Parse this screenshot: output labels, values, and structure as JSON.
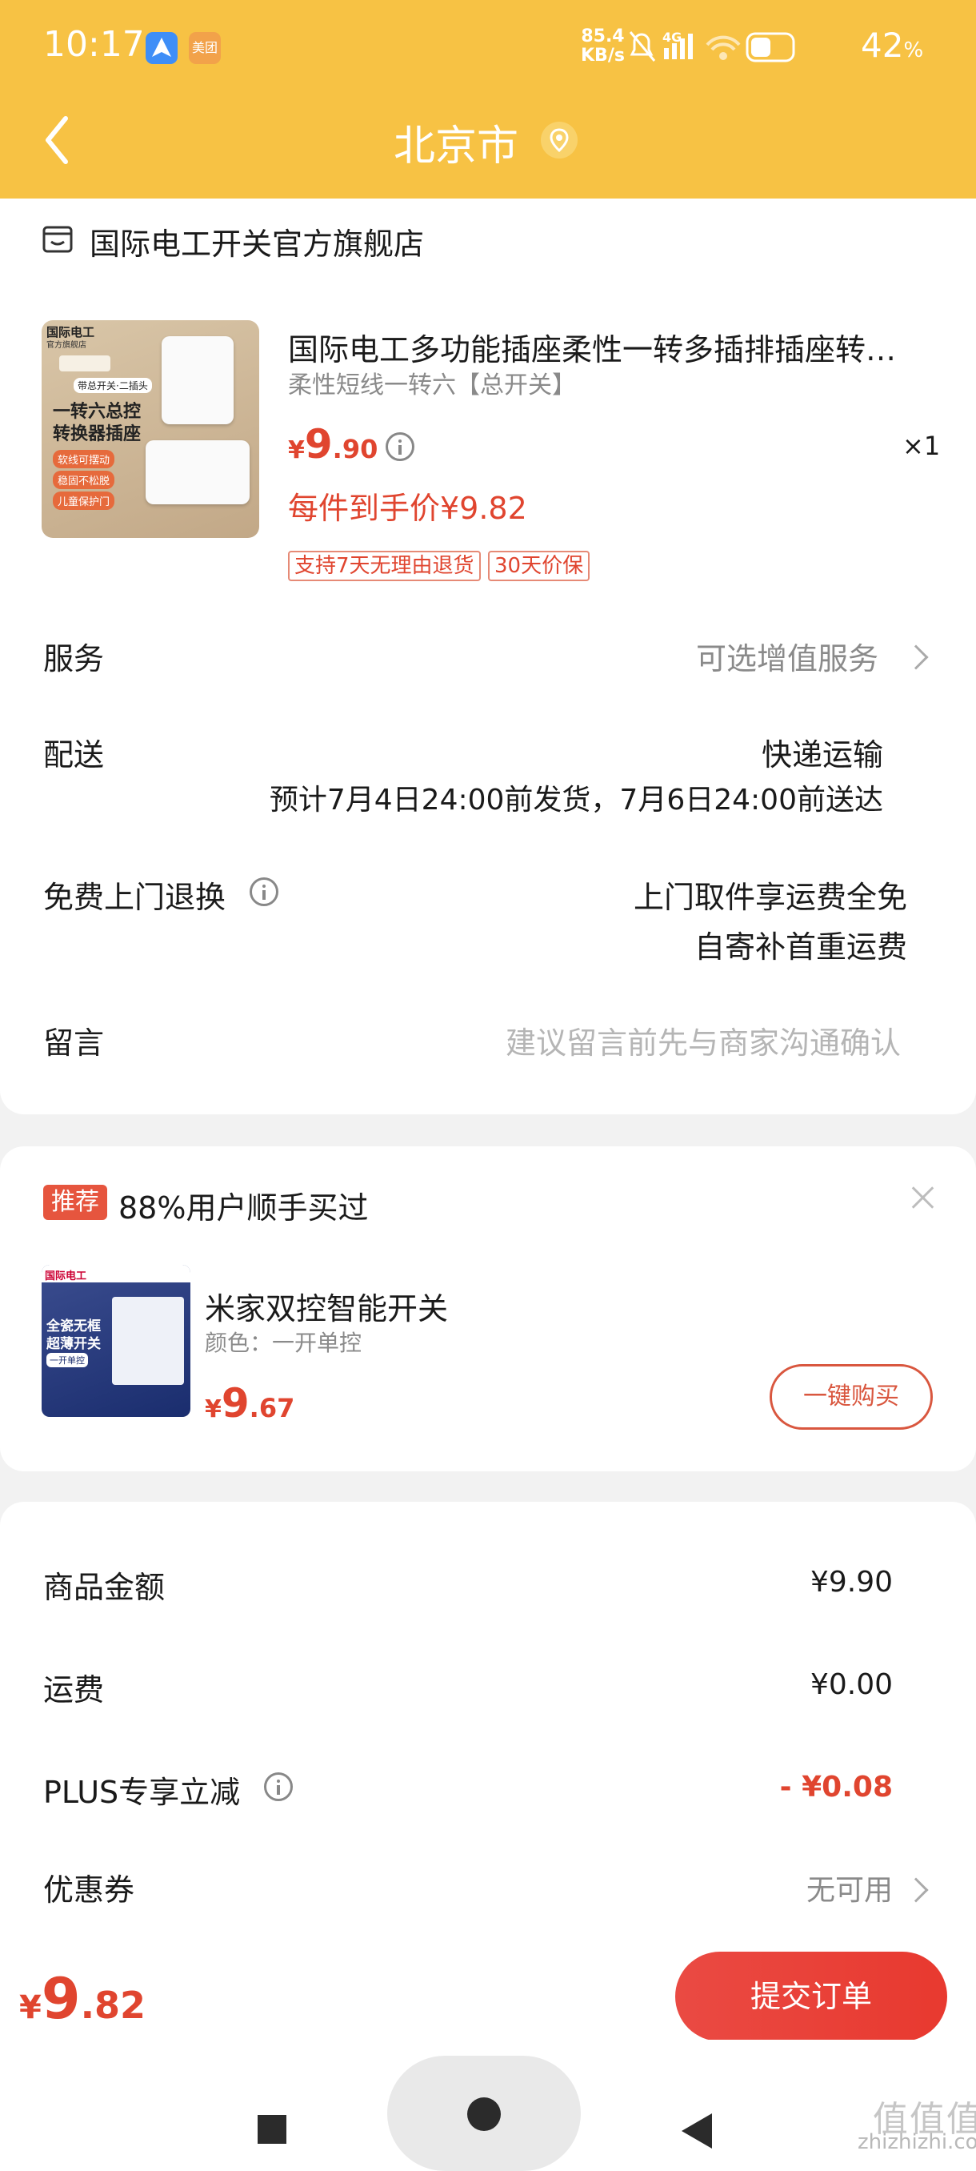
{
  "status_bar": {
    "time": "10:17",
    "app2": "美团",
    "net_speed_top": "85.4",
    "net_speed_bottom": "KB/s",
    "signal": "4G",
    "battery": "42",
    "battery_unit": "%"
  },
  "header": {
    "title": "北京市"
  },
  "store": {
    "name": "国际电工开关官方旗舰店"
  },
  "product": {
    "title": "国际电工多功能插座柔性一转多插排插座转…",
    "spec": "柔性短线一转六【总开关】",
    "price_currency": "¥",
    "price_int": "9",
    "price_dec": ".90",
    "quantity": "×1",
    "final_price": "每件到手价¥9.82",
    "tags": [
      "支持7天无理由退货",
      "30天价保"
    ],
    "image_text": {
      "brand": "国际电工",
      "brand_sub": "官方旗舰店",
      "top_label": "带总开关·二插头",
      "headline1": "一转六总控",
      "headline2": "转换器插座",
      "feature1": "软线可摆动",
      "feature2": "稳固不松脱",
      "feature3": "儿童保护门"
    }
  },
  "service": {
    "label": "服务",
    "value": "可选增值服务"
  },
  "delivery": {
    "label": "配送",
    "method": "快递运输",
    "eta": "预计7月4日24:00前发货，7月6日24:00前送达"
  },
  "return": {
    "label": "免费上门退换",
    "line1": "上门取件享运费全免",
    "line2": "自寄补首重运费"
  },
  "message": {
    "label": "留言",
    "placeholder": "建议留言前先与商家沟通确认"
  },
  "recommend": {
    "badge": "推荐",
    "title": "88%用户顺手买过",
    "item_name": "米家双控智能开关",
    "item_spec": "颜色：一开单控",
    "price_currency": "¥",
    "price_int": "9",
    "price_dec": ".67",
    "buy_label": "一键购买",
    "image_text": {
      "brand": "国际电工",
      "line1": "全瓷无框",
      "line2": "超薄开关",
      "line3": "一开单控"
    }
  },
  "amounts": [
    {
      "label": "商品金额",
      "value": "¥9.90",
      "color": "#1a1a1a"
    },
    {
      "label": "运费",
      "value": "¥0.00",
      "color": "#1a1a1a"
    },
    {
      "label": "PLUS专享立减",
      "value": "- ¥0.08",
      "color": "#e0452f"
    },
    {
      "label": "优惠券",
      "value": "无可用",
      "color": "#8a8a8a"
    }
  ],
  "total": {
    "currency": "¥",
    "int": "9",
    "dec": ".82"
  },
  "submit": {
    "label": "提交订单"
  },
  "watermark": {
    "big": "值值值",
    "small": "zhizhizhi.com"
  },
  "colors": {
    "header": "#f7c244",
    "accent_red": "#e0452f",
    "submit_button": "#e8392f"
  }
}
